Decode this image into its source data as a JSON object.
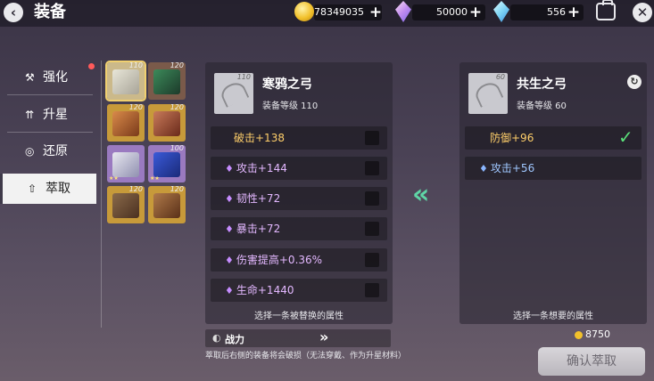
{
  "header": {
    "title": "装备",
    "resources": [
      {
        "icon": "gold-coin-icon",
        "value": "78349035"
      },
      {
        "icon": "pink-crystal-icon",
        "value": "50000"
      },
      {
        "icon": "blue-crystal-icon",
        "value": "556"
      }
    ],
    "add_label": "+"
  },
  "sidebar": {
    "items": [
      {
        "label": "强化",
        "icon": "hammer-icon",
        "has_notice": true
      },
      {
        "label": "升星",
        "icon": "star-up-icon",
        "has_notice": false
      },
      {
        "label": "还原",
        "icon": "restore-icon",
        "has_notice": false
      },
      {
        "label": "萃取",
        "icon": "extract-icon",
        "active": true
      }
    ]
  },
  "inventory": {
    "slots": [
      {
        "level": "110",
        "kind": "bow",
        "selected": true
      },
      {
        "level": "120",
        "kind": "book"
      },
      {
        "level": "120",
        "kind": "hat"
      },
      {
        "level": "120",
        "kind": "robe"
      },
      {
        "level": "",
        "kind": "gauntlet"
      },
      {
        "level": "100",
        "kind": "gloves"
      },
      {
        "level": "120",
        "kind": "belt"
      },
      {
        "level": "120",
        "kind": "boots"
      }
    ]
  },
  "left_item": {
    "name": "寒鸦之弓",
    "level_text": "装备等级 110",
    "thumb_level": "110",
    "attributes": [
      {
        "text": "破击+138",
        "color": "#ffcf6a",
        "diamond": false
      },
      {
        "text": "攻击+144",
        "color": "#e3b8ff",
        "diamond": true
      },
      {
        "text": "韧性+72",
        "color": "#e3b8ff",
        "diamond": true
      },
      {
        "text": "暴击+72",
        "color": "#e3b8ff",
        "diamond": true
      },
      {
        "text": "伤害提高+0.36%",
        "color": "#e3b8ff",
        "diamond": true
      },
      {
        "text": "生命+1440",
        "color": "#e3b8ff",
        "diamond": true
      }
    ],
    "hint": "选择一条被替换的属性"
  },
  "power": {
    "label": "战力",
    "arrows": "»"
  },
  "warning": "萃取后右侧的装备将会破损（无法穿戴、作为升星材料）",
  "right_item": {
    "name": "共生之弓",
    "level_text": "装备等级 60",
    "thumb_level": "60",
    "attributes": [
      {
        "text": "防御+96",
        "color": "#ffcf6a",
        "checked": true
      },
      {
        "text": "攻击+56",
        "color": "#9fc7ff",
        "diamond": true
      }
    ],
    "hint": "选择一条想要的属性"
  },
  "cost": "8750",
  "confirm_label": "确认萃取",
  "transfer_arrows": "«"
}
